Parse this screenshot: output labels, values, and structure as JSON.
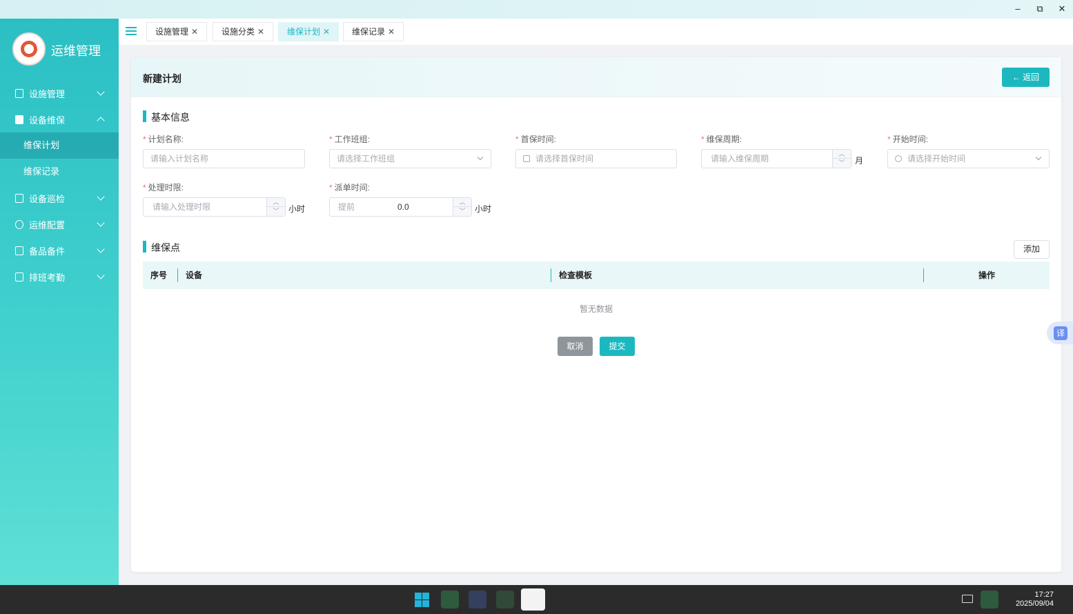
{
  "window": {
    "minimize": "–",
    "restore": "⧉",
    "close": "✕"
  },
  "app": {
    "title": "运维管理"
  },
  "sidebar": {
    "items": [
      {
        "label": "设施管理",
        "icon": "building-icon"
      },
      {
        "label": "设备维保",
        "icon": "checklist-icon",
        "expanded": true,
        "children": [
          {
            "label": "维保计划",
            "active": true
          },
          {
            "label": "维保记录"
          }
        ]
      },
      {
        "label": "设备巡检",
        "icon": "document-icon"
      },
      {
        "label": "运维配置",
        "icon": "user-icon"
      },
      {
        "label": "备品备件",
        "icon": "briefcase-icon"
      },
      {
        "label": "排班考勤",
        "icon": "calendar-icon"
      }
    ]
  },
  "tabs": [
    {
      "label": "设施管理",
      "active": false
    },
    {
      "label": "设施分类",
      "active": false
    },
    {
      "label": "维保计划",
      "active": true
    },
    {
      "label": "维保记录",
      "active": false
    }
  ],
  "page": {
    "title": "新建计划",
    "back_label": "← 返回",
    "basic_section": "基本信息",
    "fields": {
      "plan_name": {
        "label": "计划名称:",
        "placeholder": "请输入计划名称"
      },
      "team": {
        "label": "工作班组:",
        "placeholder": "请选择工作班组"
      },
      "first_time": {
        "label": "首保时间:",
        "placeholder": "请选择首保时间"
      },
      "cycle": {
        "label": "维保周期:",
        "placeholder": "请输入维保周期",
        "unit": "月"
      },
      "start_time": {
        "label": "开始时间:",
        "placeholder": "请选择开始时间"
      },
      "limit": {
        "label": "处理时限:",
        "placeholder": "请输入处理时限",
        "unit": "小时"
      },
      "dispatch": {
        "label": "派单时间:",
        "prefix": "提前",
        "value": "0.0",
        "unit": "小时"
      }
    },
    "points_section": "维保点",
    "add_label": "添加",
    "table": {
      "columns": [
        "序号",
        "设备",
        "检查模板",
        "操作"
      ],
      "empty": "暂无数据"
    },
    "cancel_label": "取消",
    "submit_label": "提交"
  },
  "translate": "译",
  "taskbar": {
    "time": "17:27",
    "date": "2025/09/04"
  },
  "colors": {
    "accent": "#1cb8c0",
    "required": "#f56c6c"
  }
}
